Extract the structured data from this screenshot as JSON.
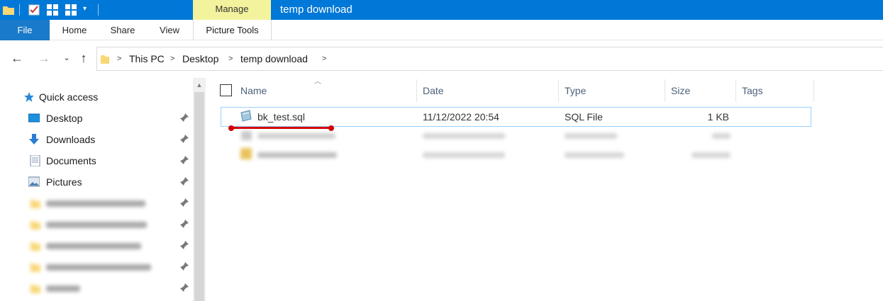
{
  "window": {
    "title": "temp download",
    "context_tab": "Manage",
    "context_group": "Picture Tools"
  },
  "ribbon": {
    "file": "File",
    "tabs": [
      "Home",
      "Share",
      "View"
    ]
  },
  "address": {
    "crumbs": [
      "This PC",
      "Desktop",
      "temp download"
    ]
  },
  "nav": {
    "quick_access": "Quick access",
    "items": [
      {
        "label": "Desktop",
        "icon": "desktop-icon"
      },
      {
        "label": "Downloads",
        "icon": "download-arrow-icon"
      },
      {
        "label": "Documents",
        "icon": "document-icon"
      },
      {
        "label": "Pictures",
        "icon": "picture-icon"
      }
    ]
  },
  "columns": [
    "Name",
    "Date",
    "Type",
    "Size",
    "Tags"
  ],
  "files": [
    {
      "name": "bk_test.sql",
      "date": "11/12/2022 20:54",
      "type": "SQL File",
      "size": "1 KB"
    }
  ],
  "colors": {
    "titlebar": "#0078d7",
    "manage": "#f3f39d",
    "file_tab": "#1979ca",
    "selection_border": "#99d1ff",
    "annotation": "#d40000"
  }
}
